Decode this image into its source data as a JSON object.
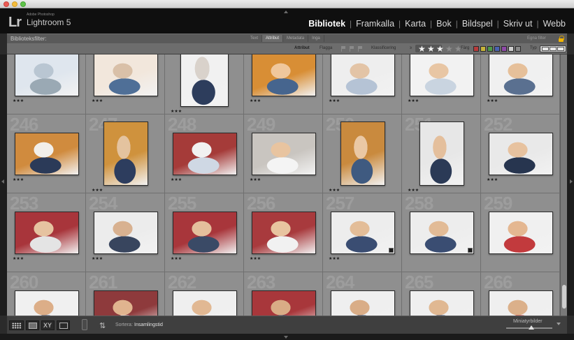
{
  "app": {
    "brand_small": "Adobe Photoshop",
    "brand_name": "Lightroom 5",
    "logo": "Lr"
  },
  "modules": [
    "Bibliotek",
    "Framkalla",
    "Karta",
    "Bok",
    "Bildspel",
    "Skriv ut",
    "Webb"
  ],
  "active_module": "Bibliotek",
  "filter": {
    "title": "Biblioteksfilter:",
    "tabs": [
      "Text",
      "Attribut",
      "Metadata",
      "Inga"
    ],
    "active_tab": "Attribut",
    "preset": "Egna filter"
  },
  "attributes": {
    "label": "Attribut",
    "flag_label": "Flagga",
    "rating_label": "Klassificering",
    "rating_operator": "≥",
    "rating_value": 3,
    "rating_max": 5,
    "color_label": "Färg",
    "color_swatches": [
      "#b83b3b",
      "#c8b43a",
      "#4e9a4a",
      "#4a62b0",
      "#8e4aa8",
      "#cfcfcf",
      "#8a8a8a"
    ],
    "type_label": "Typ"
  },
  "grid": {
    "cells": [
      {
        "num": "",
        "stars": "★★★",
        "ratio": 1.5,
        "tone": [
          "#dfe6ee",
          "#b9c6d2",
          "#9aa9b4"
        ]
      },
      {
        "num": "",
        "stars": "★★★",
        "ratio": 1.5,
        "tone": [
          "#f2e7dc",
          "#d9c0a8",
          "#4f6f97"
        ]
      },
      {
        "num": "",
        "stars": "★★★",
        "ratio": 0.75,
        "tone": [
          "#f1f1f1",
          "#d9d2cb",
          "#2d3d5c"
        ]
      },
      {
        "num": "",
        "stars": "★★★",
        "ratio": 1.5,
        "tone": [
          "#d88e35",
          "#f0c79c",
          "#46658e"
        ]
      },
      {
        "num": "",
        "stars": "★★★",
        "ratio": 1.5,
        "tone": [
          "#eeeeee",
          "#e3c4a6",
          "#b5c3d5"
        ]
      },
      {
        "num": "",
        "stars": "★★★",
        "ratio": 1.5,
        "tone": [
          "#f2f2f2",
          "#e8c6a4",
          "#c9d4e0"
        ]
      },
      {
        "num": "",
        "stars": "★★★",
        "ratio": 1.5,
        "tone": [
          "#f0f0f0",
          "#e6c09a",
          "#5a7090"
        ]
      },
      {
        "num": "246",
        "stars": "★★★",
        "ratio": 1.5,
        "tone": [
          "#d08b3e",
          "#f2efea",
          "#2b3a58"
        ]
      },
      {
        "num": "247",
        "stars": "★★★",
        "ratio": 0.7,
        "tone": [
          "#cf923d",
          "#e4c39f",
          "#2d3d5e"
        ]
      },
      {
        "num": "248",
        "stars": "★★★",
        "ratio": 1.5,
        "tone": [
          "#a53b39",
          "#f1f1f1",
          "#cfd8e4"
        ]
      },
      {
        "num": "249",
        "stars": "★★★",
        "ratio": 1.5,
        "tone": [
          "#c9c5c0",
          "#e8c4a0",
          "#f4f4f4"
        ]
      },
      {
        "num": "250",
        "stars": "★★★",
        "ratio": 0.7,
        "tone": [
          "#c98a3e",
          "#eac8a4",
          "#3f5a80"
        ]
      },
      {
        "num": "251",
        "stars": "★★★",
        "ratio": 0.7,
        "tone": [
          "#e7e7e7",
          "#e4bf9c",
          "#2b3a56"
        ]
      },
      {
        "num": "252",
        "stars": "★★★",
        "ratio": 1.5,
        "tone": [
          "#e9e9e9",
          "#e7c29f",
          "#27354f"
        ]
      },
      {
        "num": "253",
        "stars": "★★★",
        "ratio": 1.5,
        "tone": [
          "#a8353b",
          "#e6c3a0",
          "#e4e4e4"
        ]
      },
      {
        "num": "254",
        "stars": "★★★",
        "ratio": 1.5,
        "tone": [
          "#ececec",
          "#d8b190",
          "#38455e"
        ]
      },
      {
        "num": "255",
        "stars": "★★★",
        "ratio": 1.5,
        "tone": [
          "#a8363b",
          "#e4bf9c",
          "#3a4a66"
        ]
      },
      {
        "num": "256",
        "stars": "★★★",
        "ratio": 1.5,
        "tone": [
          "#a83a3d",
          "#e8c4a0",
          "#f1f1f1"
        ]
      },
      {
        "num": "257",
        "stars": "★★★",
        "ratio": 1.5,
        "tone": [
          "#ededed",
          "#e3bd98",
          "#3a4d72"
        ]
      },
      {
        "num": "258",
        "stars": "",
        "ratio": 1.5,
        "tone": [
          "#ededed",
          "#e2bb96",
          "#3a4d72"
        ]
      },
      {
        "num": "259",
        "stars": "",
        "ratio": 1.5,
        "tone": [
          "#f0f0f0",
          "#e4b791",
          "#c23a3d"
        ]
      },
      {
        "num": "260",
        "stars": "",
        "ratio": 1.5,
        "tone": [
          "#f0f0f0",
          "#dcae88",
          "#3a4d72"
        ]
      },
      {
        "num": "261",
        "stars": "",
        "ratio": 1.5,
        "tone": [
          "#8e3a3c",
          "#e0b48f",
          "#f0f0f0"
        ]
      },
      {
        "num": "262",
        "stars": "",
        "ratio": 1.5,
        "tone": [
          "#efefef",
          "#e1b893",
          "#f5f5f5"
        ]
      },
      {
        "num": "263",
        "stars": "",
        "ratio": 1.5,
        "tone": [
          "#a8373b",
          "#d9ac86",
          "#3a4d72"
        ]
      },
      {
        "num": "264",
        "stars": "",
        "ratio": 1.5,
        "tone": [
          "#efefef",
          "#d9ad87",
          "#3a4d72"
        ]
      },
      {
        "num": "265",
        "stars": "",
        "ratio": 1.5,
        "tone": [
          "#efefef",
          "#e0b892",
          "#3a4d72"
        ]
      },
      {
        "num": "266",
        "stars": "",
        "ratio": 1.5,
        "tone": [
          "#efefef",
          "#dbb08a",
          "#c93b3d"
        ]
      }
    ]
  },
  "toolbar": {
    "sort_label": "Sortera:",
    "sort_value": "Insamlingstid",
    "thumb_label": "Miniatyrbilder",
    "thumb_size": 0.55
  }
}
